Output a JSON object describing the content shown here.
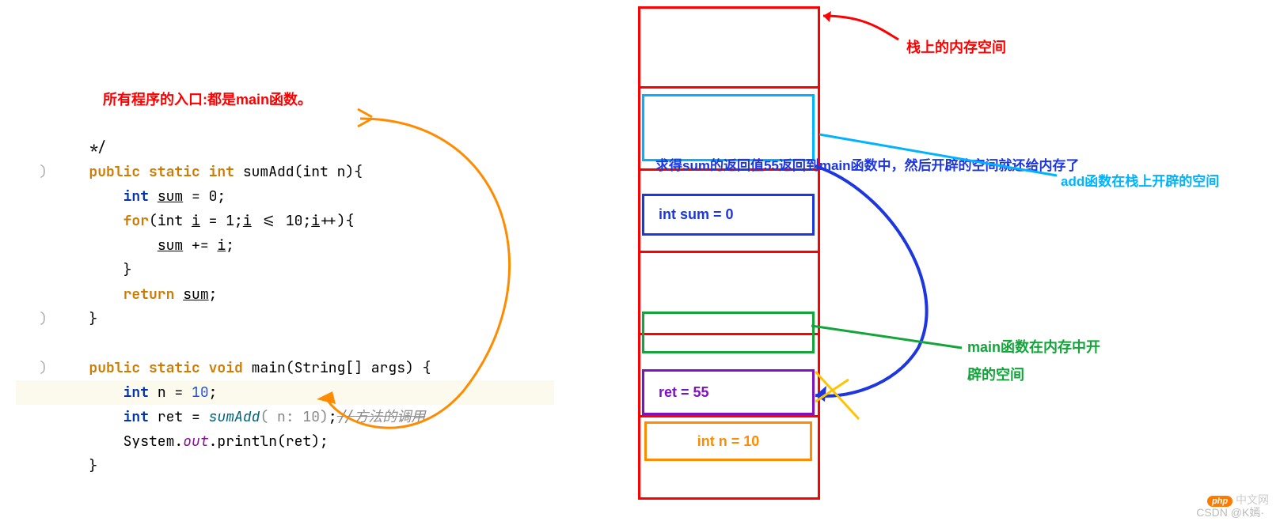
{
  "title": "所有程序的入口:都是main函数。",
  "code": {
    "comment_end": "*/",
    "sumAdd_sig_pre": "public static int ",
    "sumAdd_name": "sumAdd",
    "sumAdd_params": "(int n){",
    "line_intSum": "int ",
    "var_sum": "sum",
    "eq0": " = 0;",
    "for_kw": "for",
    "for_open": "(int ",
    "var_i": "i",
    "for_init": " = 1;",
    "for_cond": " <= 10;",
    "for_inc": "++){",
    "sum_plus": " += ",
    "semicolon": ";",
    "brace_close": "}",
    "return_kw": "return ",
    "main_sig_pre": "public static void ",
    "main_name": "main",
    "main_params": "(String[] args) {",
    "int_n": "int n = 10;",
    "int_kw": "int",
    "n_decl": " n = ",
    "ten": "10",
    "ret_decl_pre": "int ret = ",
    "sumAdd_call": "sumAdd",
    "call_args": "( n: 10)",
    "call_end": ";",
    "inline_comment": "//方法的调用",
    "println_pre": "System.",
    "out": "out",
    "println": ".println(ret);"
  },
  "stack": {
    "sum_cell": "int sum = 0",
    "ret_cell": "ret = 55",
    "n_cell": "int n = 10"
  },
  "annotations": {
    "stack_title": "栈上的内存空间",
    "sum_return": "求得sum的返回值55返回到main函数中，然后开辟的空间就还给内存了",
    "add_space": "add函数在栈上开辟的空间",
    "main_space1": "main函数在内存中开",
    "main_space2": "辟的空间"
  },
  "watermark": {
    "csdn": "CSDN @K嫣·",
    "php": "中文网"
  }
}
